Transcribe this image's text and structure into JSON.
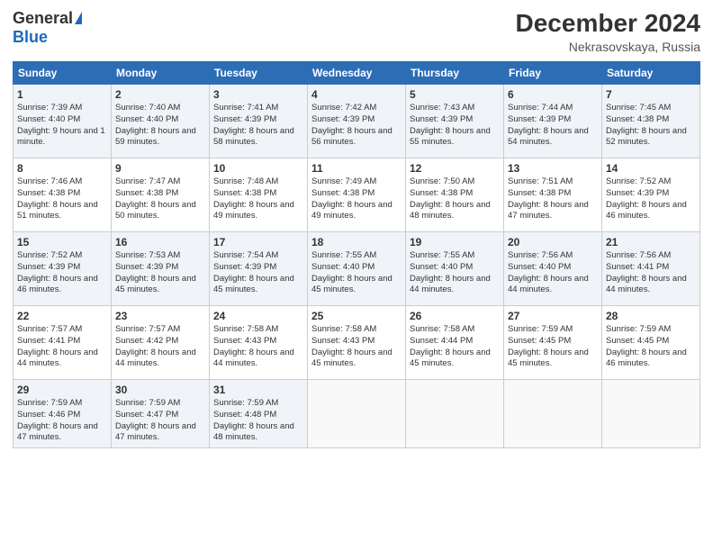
{
  "header": {
    "logo_general": "General",
    "logo_blue": "Blue",
    "month_title": "December 2024",
    "location": "Nekrasovskaya, Russia"
  },
  "weekdays": [
    "Sunday",
    "Monday",
    "Tuesday",
    "Wednesday",
    "Thursday",
    "Friday",
    "Saturday"
  ],
  "weeks": [
    [
      {
        "day": "1",
        "sunrise": "Sunrise: 7:39 AM",
        "sunset": "Sunset: 4:40 PM",
        "daylight": "Daylight: 9 hours and 1 minute."
      },
      {
        "day": "2",
        "sunrise": "Sunrise: 7:40 AM",
        "sunset": "Sunset: 4:40 PM",
        "daylight": "Daylight: 8 hours and 59 minutes."
      },
      {
        "day": "3",
        "sunrise": "Sunrise: 7:41 AM",
        "sunset": "Sunset: 4:39 PM",
        "daylight": "Daylight: 8 hours and 58 minutes."
      },
      {
        "day": "4",
        "sunrise": "Sunrise: 7:42 AM",
        "sunset": "Sunset: 4:39 PM",
        "daylight": "Daylight: 8 hours and 56 minutes."
      },
      {
        "day": "5",
        "sunrise": "Sunrise: 7:43 AM",
        "sunset": "Sunset: 4:39 PM",
        "daylight": "Daylight: 8 hours and 55 minutes."
      },
      {
        "day": "6",
        "sunrise": "Sunrise: 7:44 AM",
        "sunset": "Sunset: 4:39 PM",
        "daylight": "Daylight: 8 hours and 54 minutes."
      },
      {
        "day": "7",
        "sunrise": "Sunrise: 7:45 AM",
        "sunset": "Sunset: 4:38 PM",
        "daylight": "Daylight: 8 hours and 52 minutes."
      }
    ],
    [
      {
        "day": "8",
        "sunrise": "Sunrise: 7:46 AM",
        "sunset": "Sunset: 4:38 PM",
        "daylight": "Daylight: 8 hours and 51 minutes."
      },
      {
        "day": "9",
        "sunrise": "Sunrise: 7:47 AM",
        "sunset": "Sunset: 4:38 PM",
        "daylight": "Daylight: 8 hours and 50 minutes."
      },
      {
        "day": "10",
        "sunrise": "Sunrise: 7:48 AM",
        "sunset": "Sunset: 4:38 PM",
        "daylight": "Daylight: 8 hours and 49 minutes."
      },
      {
        "day": "11",
        "sunrise": "Sunrise: 7:49 AM",
        "sunset": "Sunset: 4:38 PM",
        "daylight": "Daylight: 8 hours and 49 minutes."
      },
      {
        "day": "12",
        "sunrise": "Sunrise: 7:50 AM",
        "sunset": "Sunset: 4:38 PM",
        "daylight": "Daylight: 8 hours and 48 minutes."
      },
      {
        "day": "13",
        "sunrise": "Sunrise: 7:51 AM",
        "sunset": "Sunset: 4:38 PM",
        "daylight": "Daylight: 8 hours and 47 minutes."
      },
      {
        "day": "14",
        "sunrise": "Sunrise: 7:52 AM",
        "sunset": "Sunset: 4:39 PM",
        "daylight": "Daylight: 8 hours and 46 minutes."
      }
    ],
    [
      {
        "day": "15",
        "sunrise": "Sunrise: 7:52 AM",
        "sunset": "Sunset: 4:39 PM",
        "daylight": "Daylight: 8 hours and 46 minutes."
      },
      {
        "day": "16",
        "sunrise": "Sunrise: 7:53 AM",
        "sunset": "Sunset: 4:39 PM",
        "daylight": "Daylight: 8 hours and 45 minutes."
      },
      {
        "day": "17",
        "sunrise": "Sunrise: 7:54 AM",
        "sunset": "Sunset: 4:39 PM",
        "daylight": "Daylight: 8 hours and 45 minutes."
      },
      {
        "day": "18",
        "sunrise": "Sunrise: 7:55 AM",
        "sunset": "Sunset: 4:40 PM",
        "daylight": "Daylight: 8 hours and 45 minutes."
      },
      {
        "day": "19",
        "sunrise": "Sunrise: 7:55 AM",
        "sunset": "Sunset: 4:40 PM",
        "daylight": "Daylight: 8 hours and 44 minutes."
      },
      {
        "day": "20",
        "sunrise": "Sunrise: 7:56 AM",
        "sunset": "Sunset: 4:40 PM",
        "daylight": "Daylight: 8 hours and 44 minutes."
      },
      {
        "day": "21",
        "sunrise": "Sunrise: 7:56 AM",
        "sunset": "Sunset: 4:41 PM",
        "daylight": "Daylight: 8 hours and 44 minutes."
      }
    ],
    [
      {
        "day": "22",
        "sunrise": "Sunrise: 7:57 AM",
        "sunset": "Sunset: 4:41 PM",
        "daylight": "Daylight: 8 hours and 44 minutes."
      },
      {
        "day": "23",
        "sunrise": "Sunrise: 7:57 AM",
        "sunset": "Sunset: 4:42 PM",
        "daylight": "Daylight: 8 hours and 44 minutes."
      },
      {
        "day": "24",
        "sunrise": "Sunrise: 7:58 AM",
        "sunset": "Sunset: 4:43 PM",
        "daylight": "Daylight: 8 hours and 44 minutes."
      },
      {
        "day": "25",
        "sunrise": "Sunrise: 7:58 AM",
        "sunset": "Sunset: 4:43 PM",
        "daylight": "Daylight: 8 hours and 45 minutes."
      },
      {
        "day": "26",
        "sunrise": "Sunrise: 7:58 AM",
        "sunset": "Sunset: 4:44 PM",
        "daylight": "Daylight: 8 hours and 45 minutes."
      },
      {
        "day": "27",
        "sunrise": "Sunrise: 7:59 AM",
        "sunset": "Sunset: 4:45 PM",
        "daylight": "Daylight: 8 hours and 45 minutes."
      },
      {
        "day": "28",
        "sunrise": "Sunrise: 7:59 AM",
        "sunset": "Sunset: 4:45 PM",
        "daylight": "Daylight: 8 hours and 46 minutes."
      }
    ],
    [
      {
        "day": "29",
        "sunrise": "Sunrise: 7:59 AM",
        "sunset": "Sunset: 4:46 PM",
        "daylight": "Daylight: 8 hours and 47 minutes."
      },
      {
        "day": "30",
        "sunrise": "Sunrise: 7:59 AM",
        "sunset": "Sunset: 4:47 PM",
        "daylight": "Daylight: 8 hours and 47 minutes."
      },
      {
        "day": "31",
        "sunrise": "Sunrise: 7:59 AM",
        "sunset": "Sunset: 4:48 PM",
        "daylight": "Daylight: 8 hours and 48 minutes."
      },
      null,
      null,
      null,
      null
    ]
  ]
}
